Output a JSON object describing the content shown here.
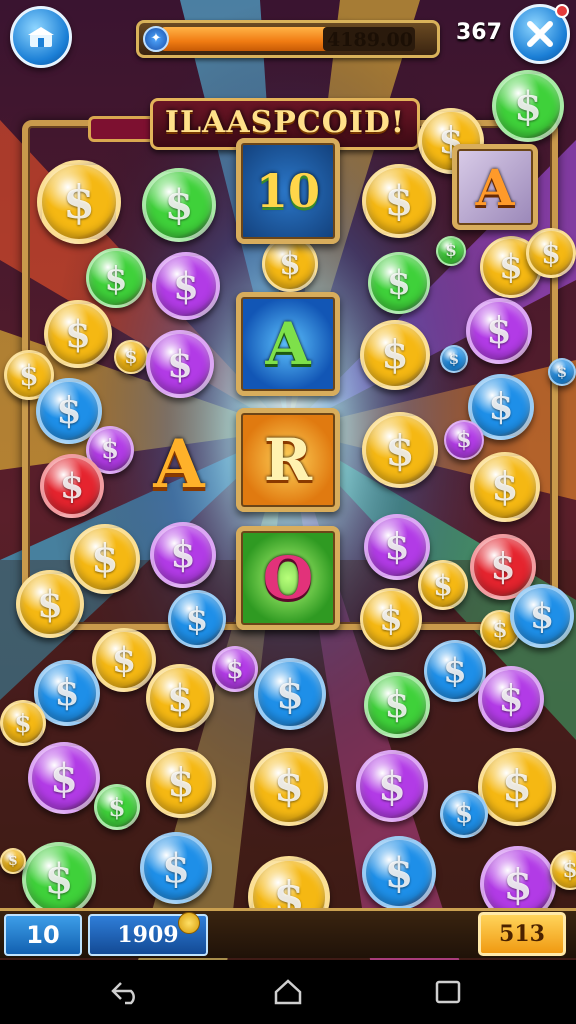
{
  "hud": {
    "balance": "4189.00",
    "balance_fill_fraction": 0.6,
    "level": "367",
    "home_icon": "shop-icon",
    "close_icon": "close-x-icon"
  },
  "board": {
    "title": "ILAASPCOID!",
    "tiles": [
      {
        "id": "ten",
        "text": "10"
      },
      {
        "id": "a-blue",
        "text": "A"
      },
      {
        "id": "r",
        "text": "R"
      },
      {
        "id": "o",
        "text": "O"
      },
      {
        "id": "a-purple",
        "text": "A"
      },
      {
        "id": "a-free",
        "text": "A"
      }
    ],
    "coin_symbol": "$"
  },
  "bottom_bar": {
    "bet": "10",
    "score": "1909",
    "win": "513"
  },
  "colors": {
    "gold": "#f5b813",
    "green": "#3fd13a",
    "purple": "#b23be6",
    "blue": "#1e8fe8",
    "red": "#e5242e",
    "frame": "#c99a4c"
  },
  "system_nav": {
    "back_icon": "back-arrow-icon",
    "home_icon": "home-outline-icon",
    "recents_icon": "recents-square-icon"
  }
}
